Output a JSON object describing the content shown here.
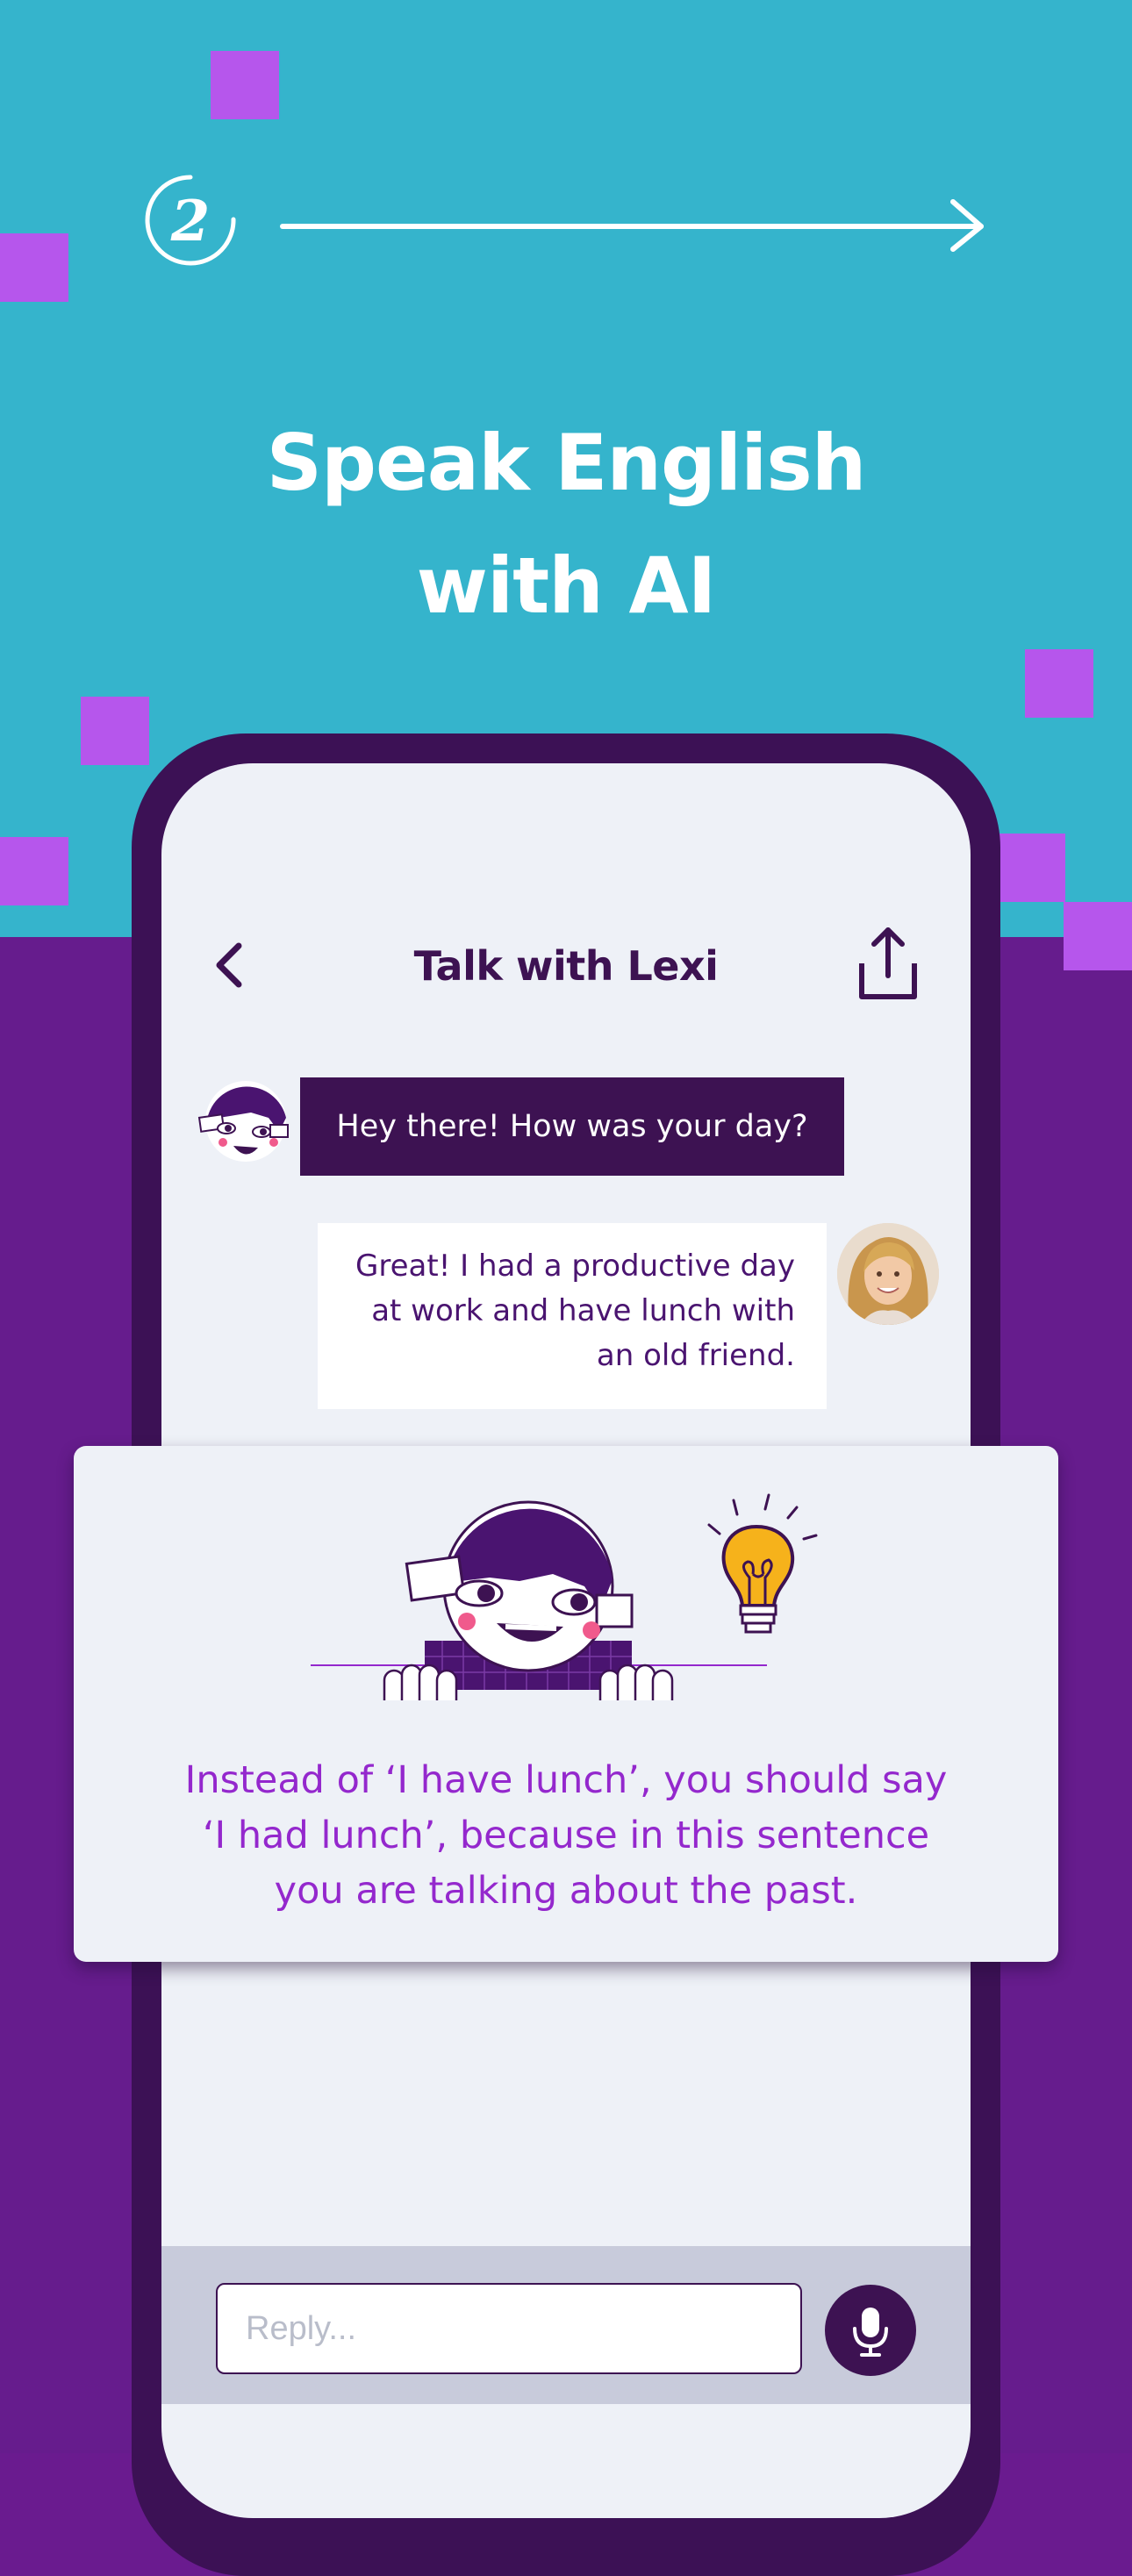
{
  "colors": {
    "top_background": "#35b4cc",
    "bottom_background": "#661c8d",
    "accent_square": "#b656ec",
    "dark_purple": "#3d1252",
    "feedback_text": "#9428cd",
    "bulb": "#f6b21b"
  },
  "step": {
    "number": "2"
  },
  "headline": {
    "line1": "Speak English",
    "line2": "with AI"
  },
  "chat": {
    "title": "Talk with Lexi",
    "messages": [
      {
        "sender": "Lexi",
        "text": "Hey there! How was your day?"
      },
      {
        "sender": "user",
        "lines": [
          "Great! I had a productive day",
          "at work and have lunch with",
          "an old friend."
        ]
      }
    ],
    "reply_placeholder": "Reply..."
  },
  "feedback": {
    "lines": [
      "Instead of ‘I have lunch’, you should say",
      "‘I had lunch’, because in this sentence",
      "you are talking about the past."
    ]
  },
  "icons": {
    "back": "chevron-left-icon",
    "share": "share-upload-icon",
    "mic": "microphone-icon",
    "bulb": "lightbulb-icon"
  }
}
